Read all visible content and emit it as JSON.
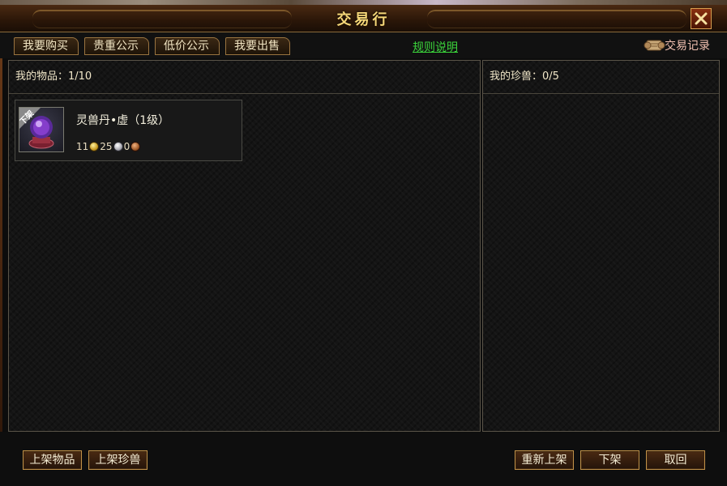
{
  "window": {
    "title": "交易行",
    "close_icon": "close-x-icon"
  },
  "tabs": [
    {
      "label": "我要购买"
    },
    {
      "label": "贵重公示"
    },
    {
      "label": "低价公示"
    },
    {
      "label": "我要出售"
    }
  ],
  "links": {
    "rules": "规则说明",
    "history": "交易记录",
    "history_icon": "scroll-icon"
  },
  "left_panel": {
    "header": "我的物品：1/10",
    "items": [
      {
        "name": "灵兽丹•虚（1级）",
        "badge": "下架",
        "icon": "crystal-orb-icon",
        "price": {
          "gold": "11",
          "silver": "25",
          "copper": "0"
        }
      }
    ]
  },
  "right_panel": {
    "header": "我的珍兽：0/5"
  },
  "footer": {
    "list_item_button": "上架物品",
    "list_pet_button": "上架珍兽",
    "relist_button": "重新上架",
    "delist_button": "下架",
    "cancel_button": "取回"
  },
  "colors": {
    "title_gold": "#f6d879",
    "rules_link_green": "#3bd43b",
    "button_border": "#c09048",
    "panel_border": "#5a5448"
  }
}
